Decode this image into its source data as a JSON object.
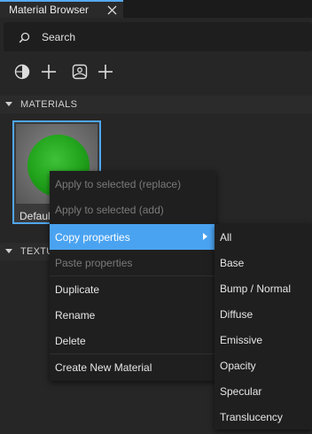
{
  "tab": {
    "title": "Material Browser",
    "close_icon": "close-icon"
  },
  "search": {
    "placeholder": "Search"
  },
  "toolbar": {
    "buttons": [
      {
        "icon": "material-sphere-icon"
      },
      {
        "icon": "plus-icon"
      },
      {
        "icon": "texture-image-icon"
      },
      {
        "icon": "plus-icon"
      }
    ]
  },
  "sections": {
    "materials": "MATERIALS",
    "textures": "TEXTU"
  },
  "material": {
    "name": "Defaul",
    "color": "#25a81f"
  },
  "context_menu": {
    "items": [
      {
        "label": "Apply to selected (replace)",
        "enabled": false
      },
      {
        "label": "Apply to selected (add)",
        "enabled": false
      },
      {
        "label": "Copy properties",
        "enabled": true,
        "active": true,
        "has_submenu": true
      },
      {
        "label": "Paste properties",
        "enabled": false
      },
      {
        "label": "Duplicate",
        "enabled": true
      },
      {
        "label": "Rename",
        "enabled": true
      },
      {
        "label": "Delete",
        "enabled": true
      },
      {
        "label": "Create New Material",
        "enabled": true
      }
    ]
  },
  "submenu": {
    "items": [
      "All",
      "Base",
      "Bump / Normal",
      "Diffuse",
      "Emissive",
      "Opacity",
      "Specular",
      "Translucency"
    ]
  },
  "colors": {
    "accent": "#4aa3f1",
    "background": "#262626",
    "menu": "#1f1f1f"
  }
}
